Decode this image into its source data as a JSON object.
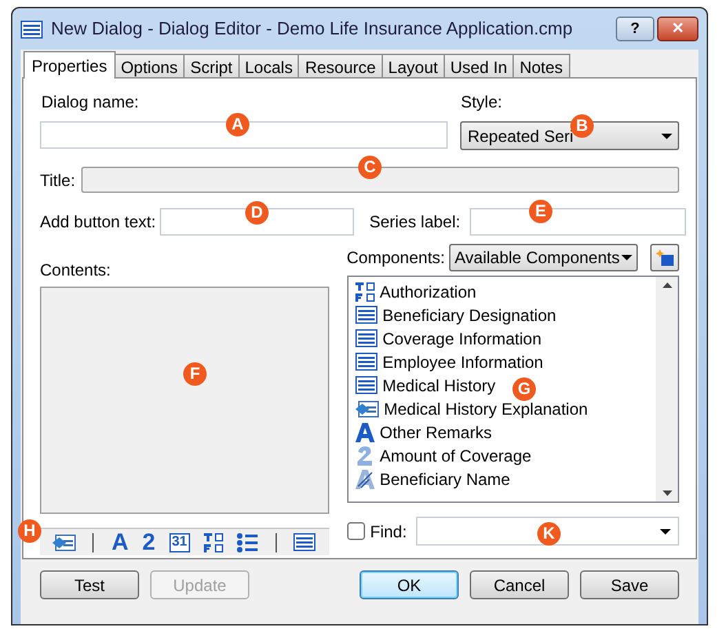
{
  "window": {
    "title": "New Dialog - Dialog Editor - Demo Life Insurance Application.cmp",
    "help": "?",
    "close": "✕"
  },
  "tabs": [
    {
      "label": "Properties",
      "selected": true
    },
    {
      "label": "Options",
      "selected": false
    },
    {
      "label": "Script",
      "selected": false
    },
    {
      "label": "Locals",
      "selected": false
    },
    {
      "label": "Resource",
      "selected": false
    },
    {
      "label": "Layout",
      "selected": false
    },
    {
      "label": "Used In",
      "selected": false
    },
    {
      "label": "Notes",
      "selected": false
    }
  ],
  "dialog_name": {
    "label": "Dialog name:"
  },
  "style": {
    "label": "Style:",
    "value": "Repeated Seri"
  },
  "title_field": {
    "label": "Title:",
    "disabled": true
  },
  "add_button_text": {
    "label": "Add button text:"
  },
  "series_label": {
    "label": "Series label:"
  },
  "contents": {
    "label": "Contents:"
  },
  "components": {
    "label": "Components:",
    "value": "Available Components",
    "items": [
      {
        "kind": "form",
        "label": "Authorization"
      },
      {
        "kind": "dialog",
        "label": "Beneficiary Designation"
      },
      {
        "kind": "dialog",
        "label": "Coverage Information"
      },
      {
        "kind": "dialog",
        "label": "Employee Information"
      },
      {
        "kind": "dialog",
        "label": "Medical History"
      },
      {
        "kind": "dialog-edit",
        "label": "Medical History Explanation"
      },
      {
        "kind": "text",
        "label": "Other Remarks"
      },
      {
        "kind": "number",
        "label": "Amount of Coverage"
      },
      {
        "kind": "text-pattern",
        "label": "Beneficiary Name"
      }
    ]
  },
  "toolbar": [
    {
      "kind": "dialog-edit"
    },
    {
      "kind": "separator"
    },
    {
      "kind": "glyph",
      "text": "A"
    },
    {
      "kind": "glyph",
      "text": "2"
    },
    {
      "kind": "calendar",
      "text": "31"
    },
    {
      "kind": "form"
    },
    {
      "kind": "list"
    },
    {
      "kind": "separator"
    },
    {
      "kind": "dialog"
    }
  ],
  "find": {
    "label": "Find:",
    "checked": false
  },
  "buttons": [
    {
      "label": "Test",
      "disabled": false,
      "default": false
    },
    {
      "label": "Update",
      "disabled": true,
      "default": false
    },
    {
      "label": "OK",
      "disabled": false,
      "default": true
    },
    {
      "label": "Cancel",
      "disabled": false,
      "default": false
    },
    {
      "label": "Save",
      "disabled": false,
      "default": false
    }
  ],
  "callouts": [
    {
      "letter": "A"
    },
    {
      "letter": "B"
    },
    {
      "letter": "C"
    },
    {
      "letter": "D"
    },
    {
      "letter": "E"
    },
    {
      "letter": "F"
    },
    {
      "letter": "G"
    },
    {
      "letter": "H"
    },
    {
      "letter": "K"
    }
  ]
}
